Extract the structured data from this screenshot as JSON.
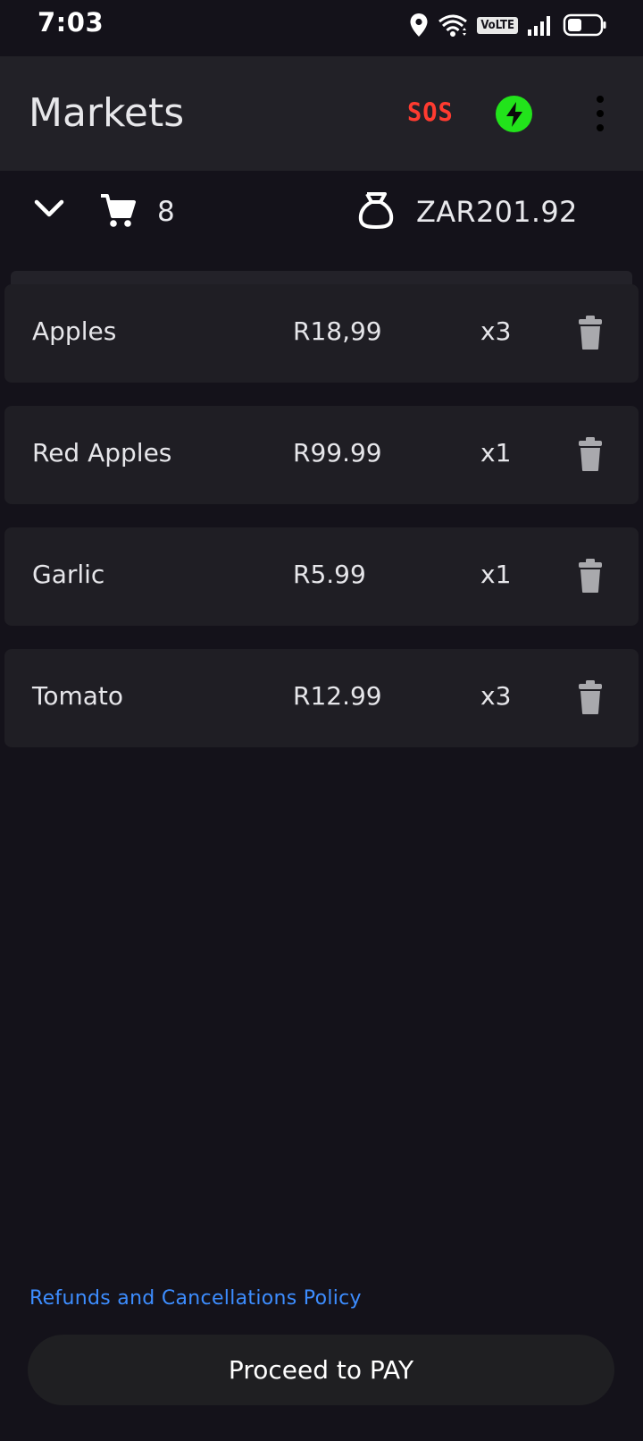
{
  "status_bar": {
    "time": "7:03",
    "volte": "VoLTE"
  },
  "app_bar": {
    "title": "Markets",
    "sos_label": "SOS",
    "accent_green": "#22e31b",
    "sos_color": "#ff3b30"
  },
  "summary": {
    "cart_count": "8",
    "total": "ZAR201.92"
  },
  "items": [
    {
      "name": "Apples",
      "price": "R18,99",
      "qty": "x3"
    },
    {
      "name": "Red Apples",
      "price": "R99.99",
      "qty": "x1"
    },
    {
      "name": "Garlic",
      "price": "R5.99",
      "qty": "x1"
    },
    {
      "name": "Tomato",
      "price": "R12.99",
      "qty": "x3"
    }
  ],
  "footer": {
    "policy_link": "Refunds and Cancellations Policy",
    "pay_label": "Proceed to PAY",
    "link_color": "#3d8dff"
  },
  "icons": {
    "location": "location-pin-icon",
    "wifi": "wifi-icon",
    "signal": "cellular-signal-icon",
    "battery": "battery-icon",
    "bolt": "lightning-bolt-icon",
    "more": "more-vertical-icon",
    "chevron": "chevron-down-icon",
    "cart": "shopping-cart-icon",
    "bag": "money-bag-icon",
    "trash": "trash-icon"
  }
}
